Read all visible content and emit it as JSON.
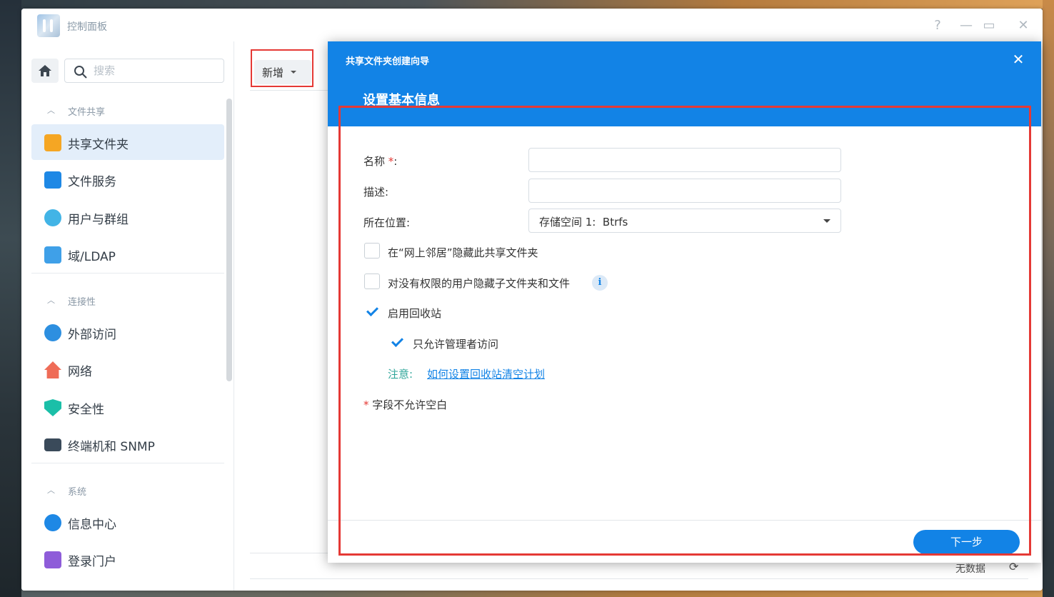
{
  "app": {
    "title": "控制面板"
  },
  "window_controls": {
    "help": "?",
    "minimize": "—",
    "maximize": "▭",
    "close": "✕"
  },
  "sidebar": {
    "search_placeholder": "搜索",
    "sections": [
      {
        "label": "文件共享",
        "items": [
          {
            "label": "共享文件夹",
            "icon": "shared-folder-icon",
            "active": true
          },
          {
            "label": "文件服务",
            "icon": "file-services-icon"
          },
          {
            "label": "用户与群组",
            "icon": "users-groups-icon"
          },
          {
            "label": "域/LDAP",
            "icon": "domain-ldap-icon"
          }
        ]
      },
      {
        "label": "连接性",
        "items": [
          {
            "label": "外部访问",
            "icon": "external-access-icon"
          },
          {
            "label": "网络",
            "icon": "network-icon"
          },
          {
            "label": "安全性",
            "icon": "security-icon"
          },
          {
            "label": "终端机和 SNMP",
            "icon": "terminal-snmp-icon"
          }
        ]
      },
      {
        "label": "系统",
        "items": [
          {
            "label": "信息中心",
            "icon": "info-center-icon"
          },
          {
            "label": "登录门户",
            "icon": "login-portal-icon"
          }
        ]
      }
    ]
  },
  "toolbar": {
    "add_label": "新增"
  },
  "status": {
    "no_data": "无数据"
  },
  "dialog": {
    "title": "共享文件夹创建向导",
    "subtitle": "设置基本信息",
    "fields": {
      "name_label": "名称",
      "name_required": "*",
      "name_colon": ":",
      "desc_label": "描述:",
      "location_label": "所在位置:",
      "location_value": "存储空间 1:  Btrfs"
    },
    "options": {
      "hide_network_label": "在“网上邻居”隐藏此共享文件夹",
      "hide_network_checked": false,
      "hide_subfolders_label": "对没有权限的用户隐藏子文件夹和文件",
      "hide_subfolders_checked": false,
      "recycle_bin_label": "启用回收站",
      "recycle_bin_checked": true,
      "admin_only_label": "只允许管理者访问",
      "admin_only_checked": true
    },
    "note_label": "注意:",
    "note_link": "如何设置回收站清空计划",
    "required_star": "*",
    "required_note": "字段不允许空白",
    "next_label": "下一步"
  },
  "colors": {
    "accent": "#1283e6",
    "highlight": "#e53935",
    "note": "#2fa69a"
  }
}
